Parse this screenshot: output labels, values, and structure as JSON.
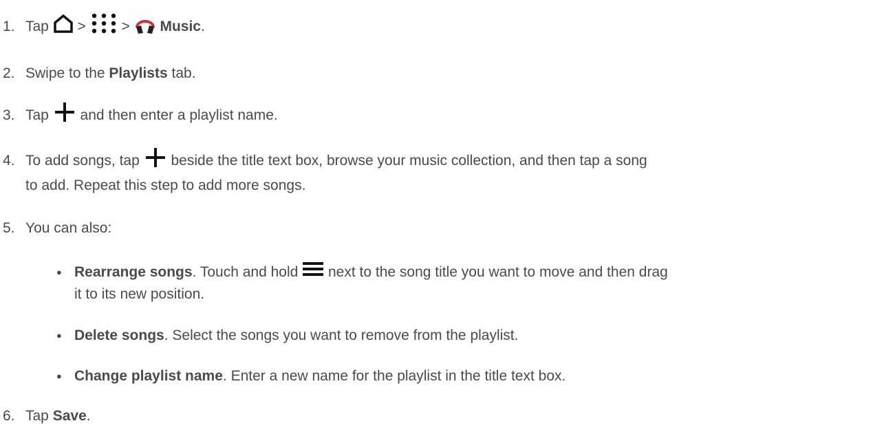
{
  "steps": {
    "s1": {
      "num": "1.",
      "tap": "Tap",
      "sep1": ">",
      "sep2": ">",
      "music": "Music",
      "end": "."
    },
    "s2": {
      "num": "2.",
      "pre": "Swipe to the",
      "bold": "Playlists",
      "post": "tab."
    },
    "s3": {
      "num": "3.",
      "pre": "Tap",
      "post": "and then enter a playlist name."
    },
    "s4": {
      "num": "4.",
      "pre": "To add songs, tap",
      "post": "beside the title text box, browse your music collection, and then tap a song",
      "line2": "to add. Repeat this step to add more songs."
    },
    "s5": {
      "num": "5.",
      "text": "You can also:"
    },
    "s6": {
      "num": "6.",
      "pre": "Tap",
      "bold": "Save",
      "end": "."
    }
  },
  "bullets": {
    "b1": {
      "bold": "Rearrange songs",
      "pre": ". Touch and hold",
      "post": "next to the song title you want to move and then drag",
      "line2": "it to its new position."
    },
    "b2": {
      "bold": "Delete songs",
      "text": ". Select the songs you want to remove from the playlist."
    },
    "b3": {
      "bold": "Change playlist name",
      "text": ". Enter a new name for the playlist in the title text box."
    }
  },
  "icons": {
    "home": "home-icon",
    "apps": "apps-grid-icon",
    "music": "headphones-icon",
    "add": "plus-icon",
    "drag": "drag-handle-icon"
  },
  "colors": {
    "text": "#4a4a4a",
    "music_icon": "#c8323c"
  }
}
